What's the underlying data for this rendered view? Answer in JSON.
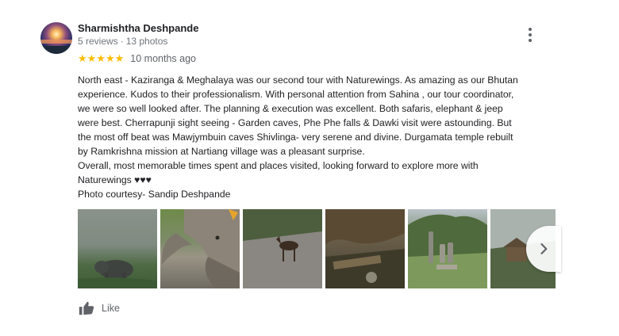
{
  "reviewer": {
    "name": "Sharmishtha Deshpande",
    "reviews": "5 reviews",
    "separator": "·",
    "photos": "13 photos"
  },
  "menu_icon": "more-vert-icon",
  "rating": {
    "value": 5,
    "max": 5,
    "stars": "★★★★★",
    "star_color": "#fbbc04",
    "date": "10 months ago"
  },
  "review_lines": [
    "North east - Kaziranga & Meghalaya was  our second tour with Naturewings. As amazing as our Bhutan",
    "experience. Kudos to their professionalism. With personal attention from Sahina , our tour coordinator,",
    "we were so well looked after. The planning & execution was excellent. Both safaris, elephant & jeep",
    "were best. Cherrapunji sight seeing - Garden caves, Phe Phe falls & Dawki visit were astounding. But",
    "the most off beat was Mawjymbuin caves Shivlinga- very serene and divine. Durgamata temple rebuilt",
    "by  Ramkrishna mission at Nartiang village was a pleasant surprise.",
    "Overall, most memorable times spent and places visited, looking forward to explore more with",
    "Naturewings ♥♥♥",
    "Photo courtesy- Sandip Deshpande"
  ],
  "photos_icon": "chevron-right-icon",
  "like": {
    "label": "Like",
    "icon": "thumb-up-icon"
  }
}
